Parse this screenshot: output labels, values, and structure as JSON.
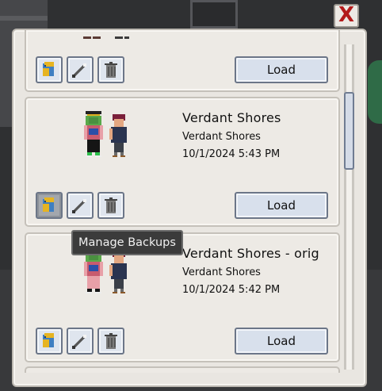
{
  "window": {
    "close_label": "X"
  },
  "saves": [
    {
      "name": "",
      "farm": "",
      "date": "",
      "load_label": "Load",
      "partial": true
    },
    {
      "name": "Verdant Shores",
      "farm": "Verdant Shores",
      "date": "10/1/2024 5:43 PM",
      "load_label": "Load"
    },
    {
      "name": "Verdant Shores - orig",
      "farm": "Verdant Shores",
      "date": "10/1/2024 5:42 PM",
      "load_label": "Load"
    }
  ],
  "tooltip": {
    "text": "Manage Backups"
  },
  "icons": {
    "backup": "backup-icon",
    "rename": "wand-icon",
    "delete": "trash-icon",
    "close": "close-icon"
  },
  "colors": {
    "close": "#b31b1b",
    "button_bg": "#d8e0ec",
    "panel": "#e9e6e1",
    "tooltip_bg": "#3b3b3b"
  }
}
